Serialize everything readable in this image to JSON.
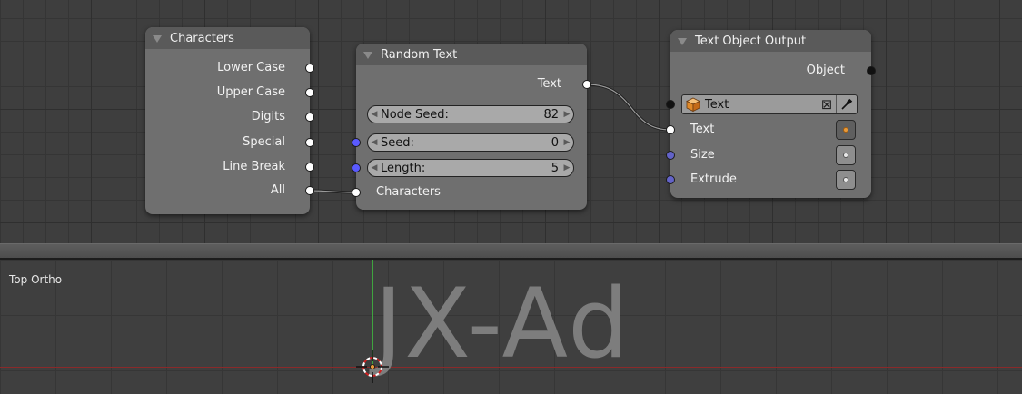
{
  "node_editor": {
    "nodes": {
      "characters": {
        "title": "Characters",
        "outputs": [
          "Lower Case",
          "Upper Case",
          "Digits",
          "Special",
          "Line Break",
          "All"
        ]
      },
      "random_text": {
        "title": "Random Text",
        "output": "Text",
        "node_seed": {
          "label": "Node Seed:",
          "value": "82"
        },
        "seed": {
          "label": "Seed:",
          "value": "0"
        },
        "length": {
          "label": "Length:",
          "value": "5"
        },
        "input": "Characters"
      },
      "text_object_output": {
        "title": "Text Object Output",
        "output": "Object",
        "object_field": {
          "value": "Text"
        },
        "inputs": [
          "Text",
          "Size",
          "Extrude"
        ]
      }
    }
  },
  "viewport": {
    "label": "Top Ortho",
    "text_object": "JX-Ad"
  },
  "colors": {
    "socket_text": "#ffffff",
    "socket_int": "#5a5aff",
    "socket_float": "#6363c8",
    "socket_object": "#111111",
    "axis_x": "#8a2a2a",
    "axis_y": "#3fa43f"
  },
  "icons": [
    "collapse-triangle-icon",
    "arrow-left-icon",
    "arrow-right-icon",
    "cube-object-icon",
    "clear-x-icon",
    "eyedropper-icon",
    "3d-cursor-icon"
  ]
}
